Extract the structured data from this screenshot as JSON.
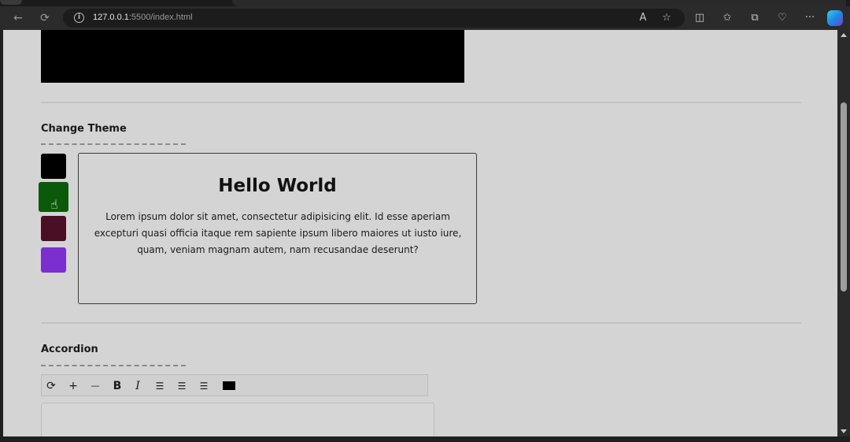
{
  "browser": {
    "url_host": "127.0.0.1",
    "url_rest": ":5500/index.html"
  },
  "theme_section": {
    "title": "Change Theme",
    "swatches": [
      {
        "name": "black",
        "color": "#000000"
      },
      {
        "name": "green",
        "color": "#0b5a0b"
      },
      {
        "name": "maroon",
        "color": "#4a0f24"
      },
      {
        "name": "purple",
        "color": "#7b2fcf"
      }
    ],
    "active_swatch": "green"
  },
  "card": {
    "title": "Hello World",
    "body": "Lorem ipsum dolor sit amet, consectetur adipisicing elit. Id esse aperiam excepturi quasi officia itaque rem sapiente ipsum libero maiores ut iusto iure, quam, veniam magnam autem, nam recusandae deserunt?"
  },
  "accordion_section": {
    "title": "Accordion",
    "tools": [
      {
        "name": "refresh-icon",
        "glyph": "⟳"
      },
      {
        "name": "plus-icon",
        "glyph": "+"
      },
      {
        "name": "minus-icon",
        "glyph": "—"
      },
      {
        "name": "bold-icon",
        "glyph": "B"
      },
      {
        "name": "italic-icon",
        "glyph": "I"
      },
      {
        "name": "align-left-icon",
        "glyph": "☰"
      },
      {
        "name": "align-center-icon",
        "glyph": "☰"
      },
      {
        "name": "align-right-icon",
        "glyph": "☰"
      }
    ]
  }
}
